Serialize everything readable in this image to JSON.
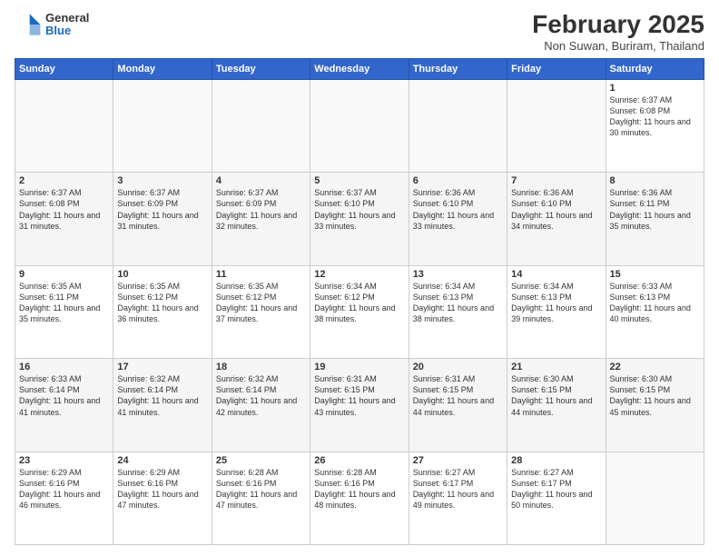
{
  "header": {
    "logo_general": "General",
    "logo_blue": "Blue",
    "month_title": "February 2025",
    "location": "Non Suwan, Buriram, Thailand"
  },
  "calendar": {
    "days_of_week": [
      "Sunday",
      "Monday",
      "Tuesday",
      "Wednesday",
      "Thursday",
      "Friday",
      "Saturday"
    ],
    "weeks": [
      [
        {
          "day": "",
          "info": "",
          "empty": true
        },
        {
          "day": "",
          "info": "",
          "empty": true
        },
        {
          "day": "",
          "info": "",
          "empty": true
        },
        {
          "day": "",
          "info": "",
          "empty": true
        },
        {
          "day": "",
          "info": "",
          "empty": true
        },
        {
          "day": "",
          "info": "",
          "empty": true
        },
        {
          "day": "1",
          "info": "Sunrise: 6:37 AM\nSunset: 6:08 PM\nDaylight: 11 hours and 30 minutes."
        }
      ],
      [
        {
          "day": "2",
          "info": "Sunrise: 6:37 AM\nSunset: 6:08 PM\nDaylight: 11 hours and 31 minutes."
        },
        {
          "day": "3",
          "info": "Sunrise: 6:37 AM\nSunset: 6:09 PM\nDaylight: 11 hours and 31 minutes."
        },
        {
          "day": "4",
          "info": "Sunrise: 6:37 AM\nSunset: 6:09 PM\nDaylight: 11 hours and 32 minutes."
        },
        {
          "day": "5",
          "info": "Sunrise: 6:37 AM\nSunset: 6:10 PM\nDaylight: 11 hours and 33 minutes."
        },
        {
          "day": "6",
          "info": "Sunrise: 6:36 AM\nSunset: 6:10 PM\nDaylight: 11 hours and 33 minutes."
        },
        {
          "day": "7",
          "info": "Sunrise: 6:36 AM\nSunset: 6:10 PM\nDaylight: 11 hours and 34 minutes."
        },
        {
          "day": "8",
          "info": "Sunrise: 6:36 AM\nSunset: 6:11 PM\nDaylight: 11 hours and 35 minutes."
        }
      ],
      [
        {
          "day": "9",
          "info": "Sunrise: 6:35 AM\nSunset: 6:11 PM\nDaylight: 11 hours and 35 minutes."
        },
        {
          "day": "10",
          "info": "Sunrise: 6:35 AM\nSunset: 6:12 PM\nDaylight: 11 hours and 36 minutes."
        },
        {
          "day": "11",
          "info": "Sunrise: 6:35 AM\nSunset: 6:12 PM\nDaylight: 11 hours and 37 minutes."
        },
        {
          "day": "12",
          "info": "Sunrise: 6:34 AM\nSunset: 6:12 PM\nDaylight: 11 hours and 38 minutes."
        },
        {
          "day": "13",
          "info": "Sunrise: 6:34 AM\nSunset: 6:13 PM\nDaylight: 11 hours and 38 minutes."
        },
        {
          "day": "14",
          "info": "Sunrise: 6:34 AM\nSunset: 6:13 PM\nDaylight: 11 hours and 39 minutes."
        },
        {
          "day": "15",
          "info": "Sunrise: 6:33 AM\nSunset: 6:13 PM\nDaylight: 11 hours and 40 minutes."
        }
      ],
      [
        {
          "day": "16",
          "info": "Sunrise: 6:33 AM\nSunset: 6:14 PM\nDaylight: 11 hours and 41 minutes."
        },
        {
          "day": "17",
          "info": "Sunrise: 6:32 AM\nSunset: 6:14 PM\nDaylight: 11 hours and 41 minutes."
        },
        {
          "day": "18",
          "info": "Sunrise: 6:32 AM\nSunset: 6:14 PM\nDaylight: 11 hours and 42 minutes."
        },
        {
          "day": "19",
          "info": "Sunrise: 6:31 AM\nSunset: 6:15 PM\nDaylight: 11 hours and 43 minutes."
        },
        {
          "day": "20",
          "info": "Sunrise: 6:31 AM\nSunset: 6:15 PM\nDaylight: 11 hours and 44 minutes."
        },
        {
          "day": "21",
          "info": "Sunrise: 6:30 AM\nSunset: 6:15 PM\nDaylight: 11 hours and 44 minutes."
        },
        {
          "day": "22",
          "info": "Sunrise: 6:30 AM\nSunset: 6:15 PM\nDaylight: 11 hours and 45 minutes."
        }
      ],
      [
        {
          "day": "23",
          "info": "Sunrise: 6:29 AM\nSunset: 6:16 PM\nDaylight: 11 hours and 46 minutes."
        },
        {
          "day": "24",
          "info": "Sunrise: 6:29 AM\nSunset: 6:16 PM\nDaylight: 11 hours and 47 minutes."
        },
        {
          "day": "25",
          "info": "Sunrise: 6:28 AM\nSunset: 6:16 PM\nDaylight: 11 hours and 47 minutes."
        },
        {
          "day": "26",
          "info": "Sunrise: 6:28 AM\nSunset: 6:16 PM\nDaylight: 11 hours and 48 minutes."
        },
        {
          "day": "27",
          "info": "Sunrise: 6:27 AM\nSunset: 6:17 PM\nDaylight: 11 hours and 49 minutes."
        },
        {
          "day": "28",
          "info": "Sunrise: 6:27 AM\nSunset: 6:17 PM\nDaylight: 11 hours and 50 minutes."
        },
        {
          "day": "",
          "info": "",
          "empty": true
        }
      ]
    ]
  }
}
